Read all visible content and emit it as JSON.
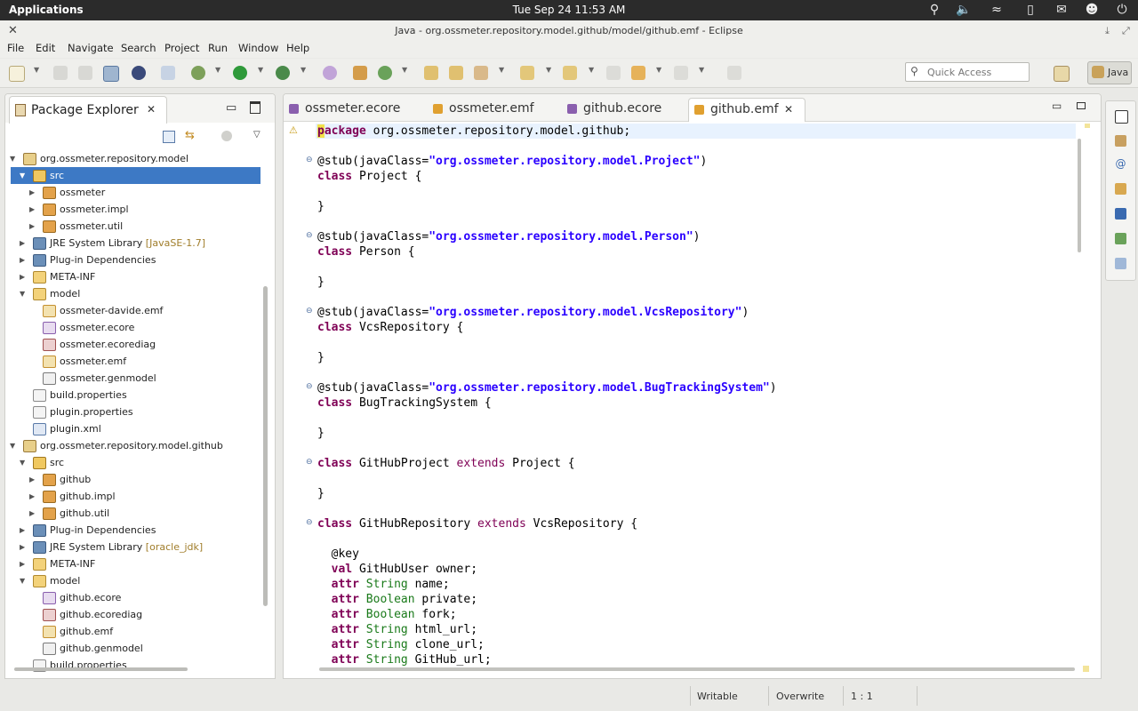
{
  "top_panel": {
    "apps_label": "Applications",
    "clock": "Tue Sep 24 11:53 AM",
    "icons": [
      "search-icon",
      "volume-icon",
      "wifi-icon",
      "battery-icon",
      "mail-icon",
      "user-icon",
      "power-icon"
    ]
  },
  "window": {
    "title": "Java - org.ossmeter.repository.model.github/model/github.emf - Eclipse"
  },
  "menu": [
    "File",
    "Edit",
    "Navigate",
    "Search",
    "Project",
    "Run",
    "Window",
    "Help"
  ],
  "toolbar": {
    "quick_access_placeholder": "Quick Access",
    "perspective": "Java"
  },
  "package_explorer": {
    "title": "Package Explorer",
    "tree": [
      {
        "label": "org.ossmeter.repository.model",
        "kind": "project",
        "expanded": true,
        "depth": 0
      },
      {
        "label": "src",
        "kind": "srcfolder",
        "expanded": true,
        "depth": 1,
        "selected": true
      },
      {
        "label": "ossmeter",
        "kind": "package",
        "expanded": false,
        "depth": 2
      },
      {
        "label": "ossmeter.impl",
        "kind": "package",
        "expanded": false,
        "depth": 2
      },
      {
        "label": "ossmeter.util",
        "kind": "package",
        "expanded": false,
        "depth": 2
      },
      {
        "label": "JRE System Library",
        "decoration": "[JavaSE-1.7]",
        "kind": "library",
        "expanded": false,
        "depth": 1
      },
      {
        "label": "Plug-in Dependencies",
        "kind": "library",
        "expanded": false,
        "depth": 1
      },
      {
        "label": "META-INF",
        "kind": "folder",
        "expanded": false,
        "depth": 1
      },
      {
        "label": "model",
        "kind": "folder",
        "expanded": true,
        "depth": 1
      },
      {
        "label": "ossmeter-davide.emf",
        "kind": "emf",
        "depth": 2
      },
      {
        "label": "ossmeter.ecore",
        "kind": "ecore",
        "depth": 2
      },
      {
        "label": "ossmeter.ecorediag",
        "kind": "diag",
        "depth": 2
      },
      {
        "label": "ossmeter.emf",
        "kind": "emf",
        "depth": 2
      },
      {
        "label": "ossmeter.genmodel",
        "kind": "genmodel",
        "depth": 2
      },
      {
        "label": "build.properties",
        "kind": "file",
        "depth": 1
      },
      {
        "label": "plugin.properties",
        "kind": "file",
        "depth": 1
      },
      {
        "label": "plugin.xml",
        "kind": "xml",
        "depth": 1
      },
      {
        "label": "org.ossmeter.repository.model.github",
        "kind": "project",
        "expanded": true,
        "depth": 0
      },
      {
        "label": "src",
        "kind": "srcfolder",
        "expanded": true,
        "depth": 1
      },
      {
        "label": "github",
        "kind": "package",
        "expanded": false,
        "depth": 2
      },
      {
        "label": "github.impl",
        "kind": "package",
        "expanded": false,
        "depth": 2
      },
      {
        "label": "github.util",
        "kind": "package",
        "expanded": false,
        "depth": 2
      },
      {
        "label": "Plug-in Dependencies",
        "kind": "library",
        "expanded": false,
        "depth": 1
      },
      {
        "label": "JRE System Library",
        "decoration": "[oracle_jdk]",
        "kind": "library",
        "expanded": false,
        "depth": 1
      },
      {
        "label": "META-INF",
        "kind": "folder",
        "expanded": false,
        "depth": 1
      },
      {
        "label": "model",
        "kind": "folder",
        "expanded": true,
        "depth": 1
      },
      {
        "label": "github.ecore",
        "kind": "ecore",
        "depth": 2
      },
      {
        "label": "github.ecorediag",
        "kind": "diag",
        "depth": 2
      },
      {
        "label": "github.emf",
        "kind": "emf",
        "depth": 2
      },
      {
        "label": "github.genmodel",
        "kind": "genmodel",
        "depth": 2
      },
      {
        "label": "build.properties",
        "kind": "file",
        "depth": 1
      }
    ]
  },
  "editor": {
    "tabs": [
      {
        "label": "ossmeter.ecore",
        "icon": "ecore-file-icon",
        "active": false
      },
      {
        "label": "ossmeter.emf",
        "icon": "emf-file-icon",
        "active": false
      },
      {
        "label": "github.ecore",
        "icon": "ecore-file-icon",
        "active": false
      },
      {
        "label": "github.emf",
        "icon": "emf-file-icon",
        "active": true
      }
    ],
    "lines": [
      {
        "row": 0,
        "parts": [
          [
            "kw",
            "package"
          ],
          [
            "",
            "org.ossmeter.repository.model.github;"
          ]
        ]
      },
      {
        "row": 2,
        "fold": true,
        "parts": [
          [
            "",
            "@stub(javaClass="
          ],
          [
            "str",
            "\"org.ossmeter.repository.model.Project\""
          ],
          [
            "",
            ")"
          ]
        ]
      },
      {
        "row": 3,
        "parts": [
          [
            "kw",
            "class"
          ],
          [
            "",
            " Project {"
          ]
        ]
      },
      {
        "row": 5,
        "parts": [
          [
            "",
            "}"
          ]
        ]
      },
      {
        "row": 7,
        "fold": true,
        "parts": [
          [
            "",
            "@stub(javaClass="
          ],
          [
            "str",
            "\"org.ossmeter.repository.model.Person\""
          ],
          [
            "",
            ")"
          ]
        ]
      },
      {
        "row": 8,
        "parts": [
          [
            "kw",
            "class"
          ],
          [
            "",
            " Person {"
          ]
        ]
      },
      {
        "row": 10,
        "parts": [
          [
            "",
            "}"
          ]
        ]
      },
      {
        "row": 12,
        "fold": true,
        "parts": [
          [
            "",
            "@stub(javaClass="
          ],
          [
            "str",
            "\"org.ossmeter.repository.model.VcsRepository\""
          ],
          [
            "",
            ")"
          ]
        ]
      },
      {
        "row": 13,
        "parts": [
          [
            "kw",
            "class"
          ],
          [
            "",
            " VcsRepository {"
          ]
        ]
      },
      {
        "row": 15,
        "parts": [
          [
            "",
            "}"
          ]
        ]
      },
      {
        "row": 17,
        "fold": true,
        "parts": [
          [
            "",
            "@stub(javaClass="
          ],
          [
            "str",
            "\"org.ossmeter.repository.model.BugTrackingSystem\""
          ],
          [
            "",
            ")"
          ]
        ]
      },
      {
        "row": 18,
        "parts": [
          [
            "kw",
            "class"
          ],
          [
            "",
            " BugTrackingSystem {"
          ]
        ]
      },
      {
        "row": 20,
        "parts": [
          [
            "",
            "}"
          ]
        ]
      },
      {
        "row": 22,
        "fold": true,
        "parts": [
          [
            "kw",
            "class"
          ],
          [
            "",
            " GitHubProject "
          ],
          [
            "kw2",
            "extends"
          ],
          [
            "",
            " Project {"
          ]
        ]
      },
      {
        "row": 24,
        "parts": [
          [
            "",
            "}"
          ]
        ]
      },
      {
        "row": 26,
        "fold": true,
        "parts": [
          [
            "kw",
            "class"
          ],
          [
            "",
            " GitHubRepository "
          ],
          [
            "kw2",
            "extends"
          ],
          [
            "",
            " VcsRepository {"
          ]
        ]
      },
      {
        "row": 28,
        "parts": [
          [
            "",
            "  @key"
          ]
        ]
      },
      {
        "row": 29,
        "parts": [
          [
            "",
            "  "
          ],
          [
            "kw",
            "val"
          ],
          [
            "",
            " GitHubUser owner;"
          ]
        ]
      },
      {
        "row": 30,
        "parts": [
          [
            "",
            "  "
          ],
          [
            "kw",
            "attr"
          ],
          [
            "ty",
            " String"
          ],
          [
            "",
            " name;"
          ]
        ]
      },
      {
        "row": 31,
        "parts": [
          [
            "",
            "  "
          ],
          [
            "kw",
            "attr"
          ],
          [
            "ty",
            " Boolean"
          ],
          [
            "",
            " private;"
          ]
        ]
      },
      {
        "row": 32,
        "parts": [
          [
            "",
            "  "
          ],
          [
            "kw",
            "attr"
          ],
          [
            "ty",
            " Boolean"
          ],
          [
            "",
            " fork;"
          ]
        ]
      },
      {
        "row": 33,
        "parts": [
          [
            "",
            "  "
          ],
          [
            "kw",
            "attr"
          ],
          [
            "ty",
            " String"
          ],
          [
            "",
            " html_url;"
          ]
        ]
      },
      {
        "row": 34,
        "parts": [
          [
            "",
            "  "
          ],
          [
            "kw",
            "attr"
          ],
          [
            "ty",
            " String"
          ],
          [
            "",
            " clone_url;"
          ]
        ]
      },
      {
        "row": 35,
        "parts": [
          [
            "",
            "  "
          ],
          [
            "kw",
            "attr"
          ],
          [
            "ty",
            " String"
          ],
          [
            "",
            " GitHub_url;"
          ]
        ]
      }
    ]
  },
  "status_bar": {
    "writable": "Writable",
    "mode": "Overwrite",
    "position": "1 : 1"
  },
  "colors": {
    "selection": "#3d79c5",
    "keyword": "#7f0055",
    "string": "#2a00ff",
    "type": "#1a7a1a"
  }
}
